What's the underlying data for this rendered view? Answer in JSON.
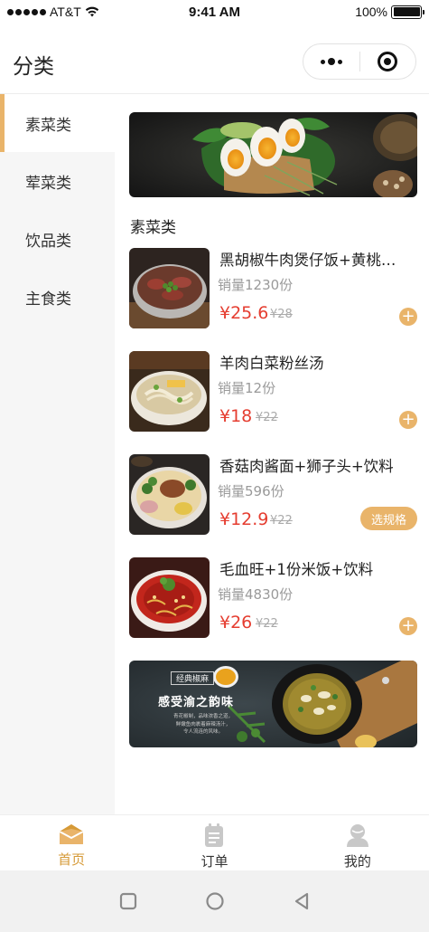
{
  "status_bar": {
    "carrier": "AT&T",
    "time": "9:41 AM",
    "battery": "100%"
  },
  "nav": {
    "title": "分类"
  },
  "sidebar": {
    "items": [
      {
        "label": "素菜类",
        "active": true
      },
      {
        "label": "荤菜类",
        "active": false
      },
      {
        "label": "饮品类",
        "active": false
      },
      {
        "label": "主食类",
        "active": false
      }
    ]
  },
  "main": {
    "section_title": "素菜类",
    "products": [
      {
        "name": "黑胡椒牛肉煲仔饭+黄桃罐头",
        "sales": "销量1230份",
        "price": "¥25.6",
        "original_price": "¥28",
        "action": "add"
      },
      {
        "name": "羊肉白菜粉丝汤",
        "sales": "销量12份",
        "price": "¥18",
        "original_price": "¥22",
        "action": "add"
      },
      {
        "name": "香菇肉酱面+狮子头+饮料",
        "sales": "销量596份",
        "price": "¥12.9",
        "original_price": "¥22",
        "action": "spec",
        "spec_label": "选规格"
      },
      {
        "name": "毛血旺+1份米饭+饮料",
        "sales": "销量4830份",
        "price": "¥26",
        "original_price": "¥22",
        "action": "add"
      }
    ],
    "bottom_banner": {
      "tag": "经典椒麻",
      "headline": "感受渝之韵味",
      "caption_line1": "青花椒制，品味浓香之道，",
      "caption_line2": "鲜嫩鱼肉裹着麻辣汤汁，",
      "caption_line3": "令人流连的风味。"
    }
  },
  "tab_bar": {
    "tabs": [
      {
        "label": "首页",
        "icon": "home-icon",
        "active": true
      },
      {
        "label": "订单",
        "icon": "order-icon",
        "active": false
      },
      {
        "label": "我的",
        "icon": "user-icon",
        "active": false
      }
    ]
  },
  "colors": {
    "accent": "#e9b46a",
    "active_tab": "#d69a37",
    "price": "#e53d30",
    "sidebar_bg": "#f6f6f6"
  }
}
